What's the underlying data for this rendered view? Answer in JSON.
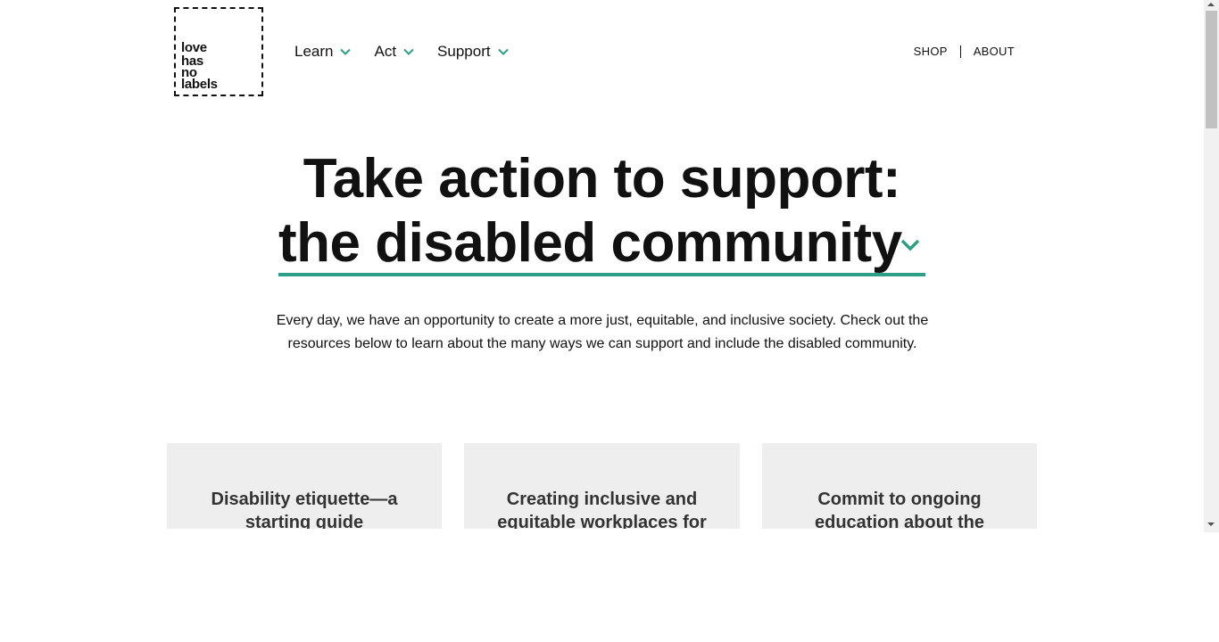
{
  "brand": {
    "logo_lines": [
      "love",
      "has",
      "no",
      "labels"
    ]
  },
  "nav": {
    "items": [
      {
        "label": "Learn"
      },
      {
        "label": "Act"
      },
      {
        "label": "Support"
      }
    ]
  },
  "utility_nav": {
    "shop": "SHOP",
    "about": "ABOUT"
  },
  "hero": {
    "title_line1": "Take action to support:",
    "selected_community": "the disabled community",
    "intro": "Every day, we have an opportunity to create a more just, equitable, and inclusive society. Check out the resources below to learn about the many ways we can support and include the disabled community."
  },
  "cards": [
    {
      "title": "Disability etiquette—a starting guide"
    },
    {
      "title": "Creating inclusive and equitable workplaces for"
    },
    {
      "title": "Commit to ongoing education about the"
    }
  ],
  "colors": {
    "accent": "#2e9e86",
    "card_bg": "#eeeeee",
    "text": "#111111"
  },
  "icons": {
    "nav_dropdown": "chevron-down-icon",
    "hero_dropdown": "chevron-down-icon"
  }
}
